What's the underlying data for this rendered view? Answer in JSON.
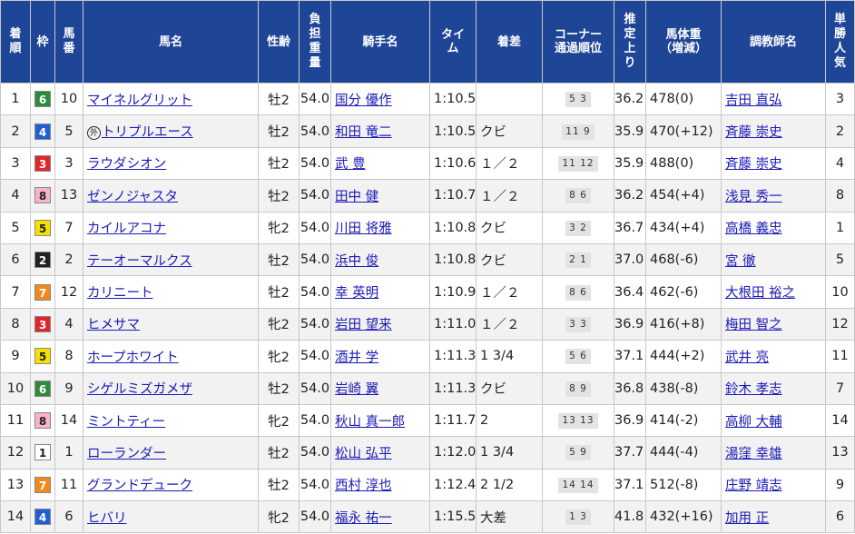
{
  "headers": {
    "rank": "着\n順",
    "waku": "枠",
    "umaban": "馬\n番",
    "horse": "馬名",
    "sexage": "性齢",
    "weight": "負\n担\n重\n量",
    "jockey": "騎手名",
    "time": "タイ\nム",
    "margin": "着差",
    "corner": "コーナー\n通過順位",
    "last3f": "推\n定\n上\nり",
    "body": "馬体重\n（増減）",
    "trainer": "調教師名",
    "pop": "単\n勝\n人\n気"
  },
  "waku_colors": {
    "1": {
      "bg": "#ffffff",
      "fg": "#222222"
    },
    "2": {
      "bg": "#222222",
      "fg": "#ffffff"
    },
    "3": {
      "bg": "#e0262a",
      "fg": "#ffffff"
    },
    "4": {
      "bg": "#1f5fcf",
      "fg": "#ffffff"
    },
    "5": {
      "bg": "#f5e000",
      "fg": "#222222"
    },
    "6": {
      "bg": "#2f8a3a",
      "fg": "#ffffff"
    },
    "7": {
      "bg": "#f08a1c",
      "fg": "#ffffff"
    },
    "8": {
      "bg": "#f7b4c6",
      "fg": "#222222"
    }
  },
  "foreign_mark": "外",
  "rows": [
    {
      "rank": "1",
      "waku": "6",
      "umaban": "10",
      "horse": "マイネルグリット",
      "foreign": false,
      "sexage": "牡2",
      "weight": "54.0",
      "jockey": "国分 優作",
      "time": "1:10.5",
      "margin": "",
      "corner": "5 3",
      "last3f": "36.2",
      "body": "478(0)",
      "trainer": "吉田 直弘",
      "pop": "3"
    },
    {
      "rank": "2",
      "waku": "4",
      "umaban": "5",
      "horse": "トリプルエース",
      "foreign": true,
      "sexage": "牡2",
      "weight": "54.0",
      "jockey": "和田 竜二",
      "time": "1:10.5",
      "margin": "クビ",
      "corner": "11 9",
      "last3f": "35.9",
      "body": "470(+12)",
      "trainer": "斉藤 崇史",
      "pop": "2"
    },
    {
      "rank": "3",
      "waku": "3",
      "umaban": "3",
      "horse": "ラウダシオン",
      "foreign": false,
      "sexage": "牡2",
      "weight": "54.0",
      "jockey": "武 豊",
      "time": "1:10.6",
      "margin": "１／２",
      "corner": "11 12",
      "last3f": "35.9",
      "body": "488(0)",
      "trainer": "斉藤 崇史",
      "pop": "4"
    },
    {
      "rank": "4",
      "waku": "8",
      "umaban": "13",
      "horse": "ゼンノジャスタ",
      "foreign": false,
      "sexage": "牡2",
      "weight": "54.0",
      "jockey": "田中 健",
      "time": "1:10.7",
      "margin": "１／２",
      "corner": "8 6",
      "last3f": "36.2",
      "body": "454(+4)",
      "trainer": "浅見 秀一",
      "pop": "8"
    },
    {
      "rank": "5",
      "waku": "5",
      "umaban": "7",
      "horse": "カイルアコナ",
      "foreign": false,
      "sexage": "牝2",
      "weight": "54.0",
      "jockey": "川田 将雅",
      "time": "1:10.8",
      "margin": "クビ",
      "corner": "3 2",
      "last3f": "36.7",
      "body": "434(+4)",
      "trainer": "高橋 義忠",
      "pop": "1"
    },
    {
      "rank": "6",
      "waku": "2",
      "umaban": "2",
      "horse": "テーオーマルクス",
      "foreign": false,
      "sexage": "牡2",
      "weight": "54.0",
      "jockey": "浜中 俊",
      "time": "1:10.8",
      "margin": "クビ",
      "corner": "2 1",
      "last3f": "37.0",
      "body": "468(-6)",
      "trainer": "宮 徹",
      "pop": "5"
    },
    {
      "rank": "7",
      "waku": "7",
      "umaban": "12",
      "horse": "カリニート",
      "foreign": false,
      "sexage": "牡2",
      "weight": "54.0",
      "jockey": "幸 英明",
      "time": "1:10.9",
      "margin": "１／２",
      "corner": "8 6",
      "last3f": "36.4",
      "body": "462(-6)",
      "trainer": "大根田 裕之",
      "pop": "10"
    },
    {
      "rank": "8",
      "waku": "3",
      "umaban": "4",
      "horse": "ヒメサマ",
      "foreign": false,
      "sexage": "牝2",
      "weight": "54.0",
      "jockey": "岩田 望来",
      "time": "1:11.0",
      "margin": "１／２",
      "corner": "3 3",
      "last3f": "36.9",
      "body": "416(+8)",
      "trainer": "梅田 智之",
      "pop": "12"
    },
    {
      "rank": "9",
      "waku": "5",
      "umaban": "8",
      "horse": "ホープホワイト",
      "foreign": false,
      "sexage": "牝2",
      "weight": "54.0",
      "jockey": "酒井 学",
      "time": "1:11.3",
      "margin": "1 3/4",
      "corner": "5 6",
      "last3f": "37.1",
      "body": "444(+2)",
      "trainer": "武井 亮",
      "pop": "11"
    },
    {
      "rank": "10",
      "waku": "6",
      "umaban": "9",
      "horse": "シゲルミズガメザ",
      "foreign": false,
      "sexage": "牡2",
      "weight": "54.0",
      "jockey": "岩崎 翼",
      "time": "1:11.3",
      "margin": "クビ",
      "corner": "8 9",
      "last3f": "36.8",
      "body": "438(-8)",
      "trainer": "鈴木 孝志",
      "pop": "7"
    },
    {
      "rank": "11",
      "waku": "8",
      "umaban": "14",
      "horse": "ミントティー",
      "foreign": false,
      "sexage": "牝2",
      "weight": "54.0",
      "jockey": "秋山 真一郎",
      "time": "1:11.7",
      "margin": "2",
      "corner": "13 13",
      "last3f": "36.9",
      "body": "414(-2)",
      "trainer": "高柳 大輔",
      "pop": "14"
    },
    {
      "rank": "12",
      "waku": "1",
      "umaban": "1",
      "horse": "ローランダー",
      "foreign": false,
      "sexage": "牡2",
      "weight": "54.0",
      "jockey": "松山 弘平",
      "time": "1:12.0",
      "margin": "1 3/4",
      "corner": "5 9",
      "last3f": "37.7",
      "body": "444(-4)",
      "trainer": "湯窪 幸雄",
      "pop": "13"
    },
    {
      "rank": "13",
      "waku": "7",
      "umaban": "11",
      "horse": "グランドデューク",
      "foreign": false,
      "sexage": "牡2",
      "weight": "54.0",
      "jockey": "西村 淳也",
      "time": "1:12.4",
      "margin": "2 1/2",
      "corner": "14 14",
      "last3f": "37.1",
      "body": "512(-8)",
      "trainer": "庄野 靖志",
      "pop": "9"
    },
    {
      "rank": "14",
      "waku": "4",
      "umaban": "6",
      "horse": "ヒバリ",
      "foreign": false,
      "sexage": "牝2",
      "weight": "54.0",
      "jockey": "福永 祐一",
      "time": "1:15.5",
      "margin": "大差",
      "corner": "1 3",
      "last3f": "41.8",
      "body": "432(+16)",
      "trainer": "加用 正",
      "pop": "6"
    }
  ]
}
